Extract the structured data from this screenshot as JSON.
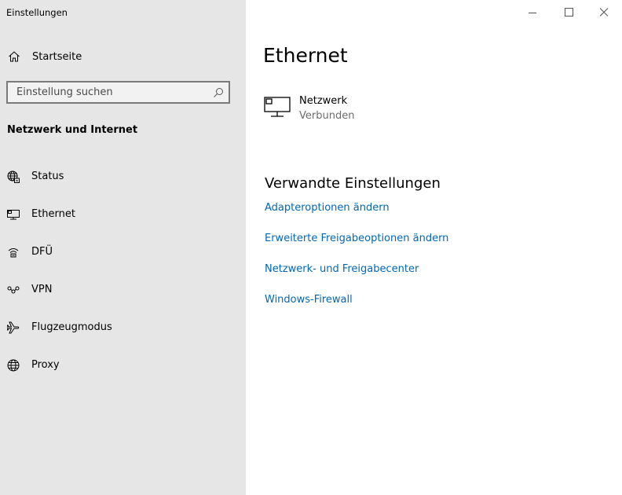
{
  "window": {
    "title": "Einstellungen",
    "controls": {
      "minimize": "minimize-icon",
      "maximize": "maximize-icon",
      "close": "close-icon"
    }
  },
  "sidebar": {
    "home_label": "Startseite",
    "home_icon": "home-icon",
    "search": {
      "placeholder": "Einstellung suchen",
      "value": "",
      "icon": "search-icon"
    },
    "section_title": "Netzwerk und Internet",
    "items": [
      {
        "label": "Status",
        "icon": "globe-status-icon"
      },
      {
        "label": "Ethernet",
        "icon": "ethernet-icon"
      },
      {
        "label": "DFÜ",
        "icon": "dial-up-icon"
      },
      {
        "label": "VPN",
        "icon": "vpn-icon"
      },
      {
        "label": "Flugzeugmodus",
        "icon": "airplane-icon"
      },
      {
        "label": "Proxy",
        "icon": "globe-icon"
      }
    ]
  },
  "main": {
    "title": "Ethernet",
    "network": {
      "name": "Netzwerk",
      "status": "Verbunden",
      "icon": "ethernet-network-icon"
    },
    "related": {
      "heading": "Verwandte Einstellungen",
      "links": [
        "Adapteroptionen ändern",
        "Erweiterte Freigabeoptionen ändern",
        "Netzwerk- und Freigabecenter",
        "Windows-Firewall"
      ]
    }
  },
  "colors": {
    "sidebar_bg": "#e6e6e6",
    "main_bg": "#ffffff",
    "link": "#0067b8",
    "muted_text": "#6d6d6d",
    "search_border": "#7a7a7a"
  }
}
